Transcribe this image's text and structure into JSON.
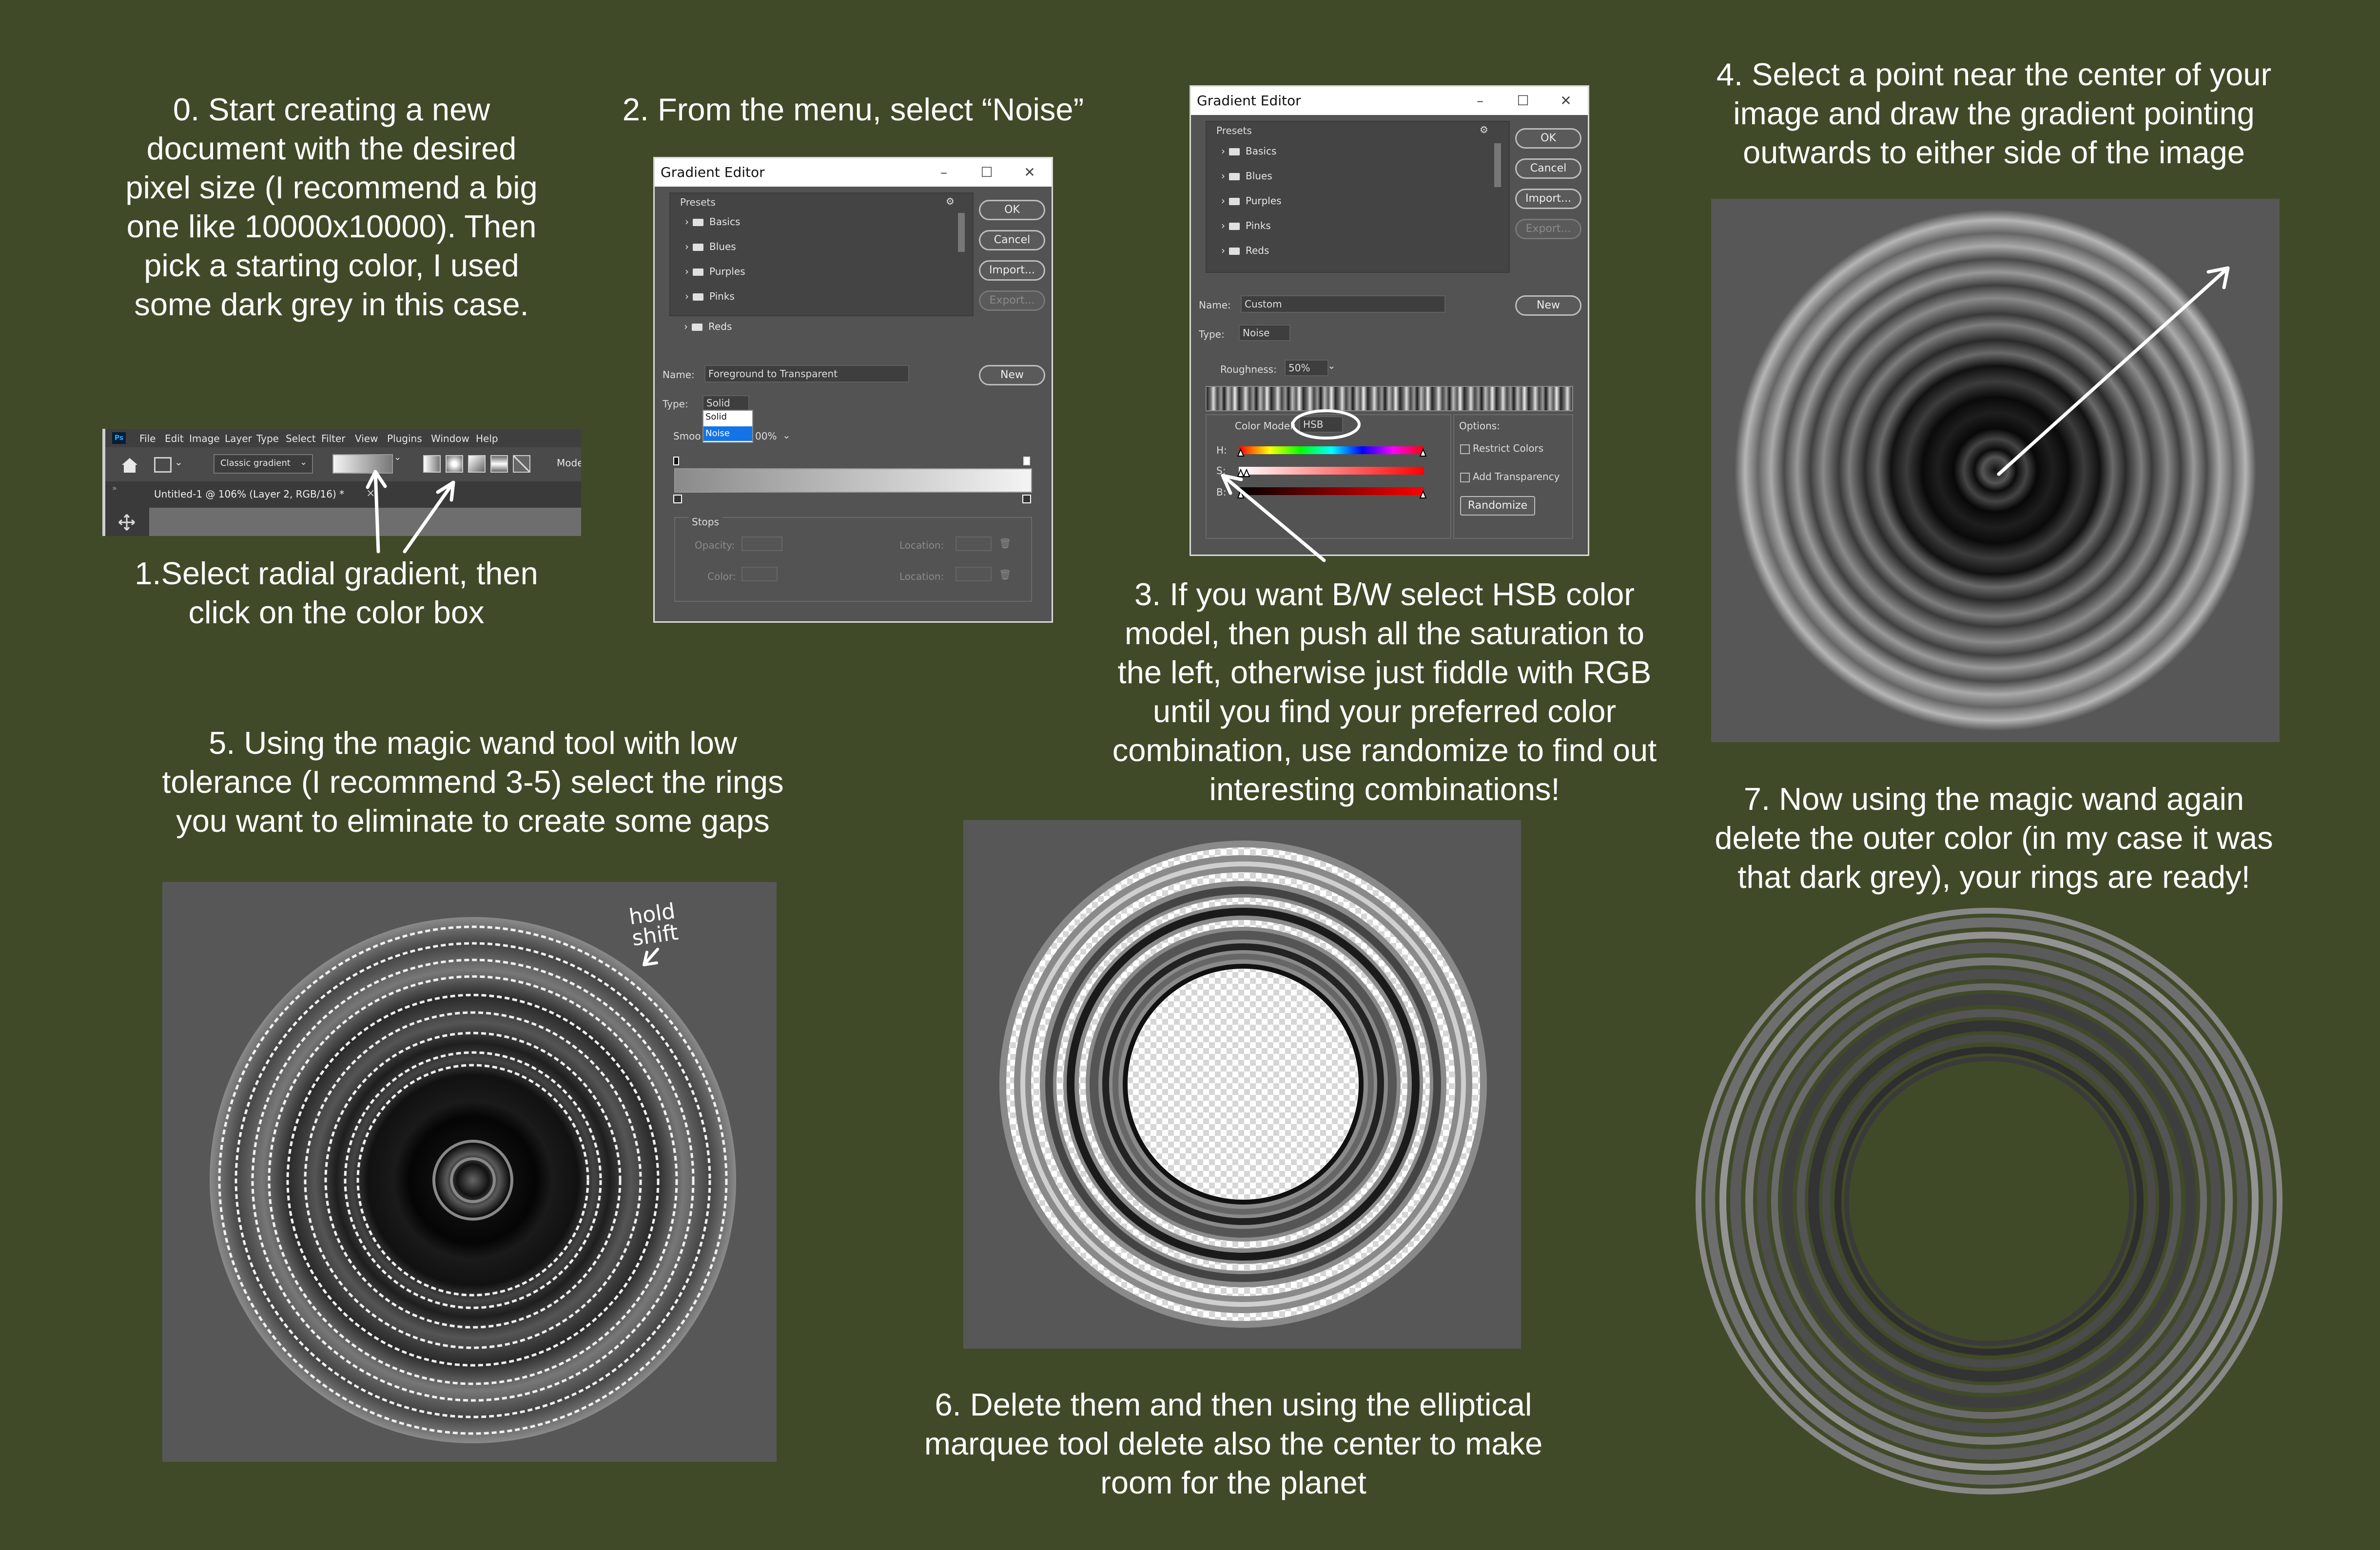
{
  "captions": {
    "step0": "0. Start creating a new\ndocument with the desired\npixel size (I recommend a big\none like 10000x10000). Then\npick a starting color, I used\nsome dark grey in this case.",
    "step1": "1.Select radial gradient, then\nclick on the color box",
    "step2": "2. From the menu, select “Noise”",
    "step3": "3. If you want B/W select HSB color\nmodel, then push all the saturation to\nthe left, otherwise just fiddle with RGB\nuntil you find your preferred color\ncombination, use randomize to find out\ninteresting combinations!",
    "step4": "4. Select a point near the center of your\nimage and draw the gradient pointing\noutwards to either side of the image",
    "step5": "5. Using the magic wand tool with low\ntolerance (I recommend 3-5) select the rings\nyou want to eliminate to create some gaps",
    "step6": "6. Delete them and then using the elliptical\nmarquee tool delete also the center to make\nroom for the planet",
    "step7": "7. Now using the magic wand again\ndelete the outer color (in my case it was\nthat dark grey), your rings are ready!",
    "hold_shift": "hold\nshift"
  },
  "photoshop_bar": {
    "app_badge": "Ps",
    "menu": [
      "File",
      "Edit",
      "Image",
      "Layer",
      "Type",
      "Select",
      "Filter",
      "View",
      "Plugins",
      "Window",
      "Help"
    ],
    "gradient_preset": "Classic gradient",
    "mode_label": "Mode",
    "doc_tab": "Untitled-1 @ 106% (Layer 2, RGB/16) *",
    "doc_tab_close": "×"
  },
  "editor1": {
    "title": "Gradient Editor",
    "presets_label": "Presets",
    "presets": [
      "Basics",
      "Blues",
      "Purples",
      "Pinks",
      "Reds"
    ],
    "ok": "OK",
    "cancel": "Cancel",
    "import": "Import...",
    "export": "Export...",
    "name_label": "Name:",
    "name_value": "Foreground to Transparent",
    "new": "New",
    "type_label": "Type:",
    "type_value": "Solid",
    "type_options": [
      "Solid",
      "Noise"
    ],
    "smooth_label": "Smoo",
    "smooth_value": "00%",
    "stops_label": "Stops",
    "opacity_label": "Opacity:",
    "location_label": "Location:",
    "color_label": "Color:"
  },
  "editor2": {
    "title": "Gradient Editor",
    "presets_label": "Presets",
    "presets": [
      "Basics",
      "Blues",
      "Purples",
      "Pinks",
      "Reds"
    ],
    "ok": "OK",
    "cancel": "Cancel",
    "import": "Import...",
    "export": "Export...",
    "name_label": "Name:",
    "name_value": "Custom",
    "new": "New",
    "type_label": "Type:",
    "type_value": "Noise",
    "roughness_label": "Roughness:",
    "roughness_value": "50%",
    "color_model_label": "Color Model:",
    "color_model_value": "HSB",
    "h_label": "H:",
    "s_label": "S:",
    "b_label": "B:",
    "options_label": "Options:",
    "restrict_colors": "Restrict Colors",
    "add_transparency": "Add Transparency",
    "randomize": "Randomize"
  },
  "colors": {
    "background": "#414a28",
    "dialog_bg": "#535353",
    "selection_blue": "#1473e6",
    "ring_fill": "#575757"
  }
}
